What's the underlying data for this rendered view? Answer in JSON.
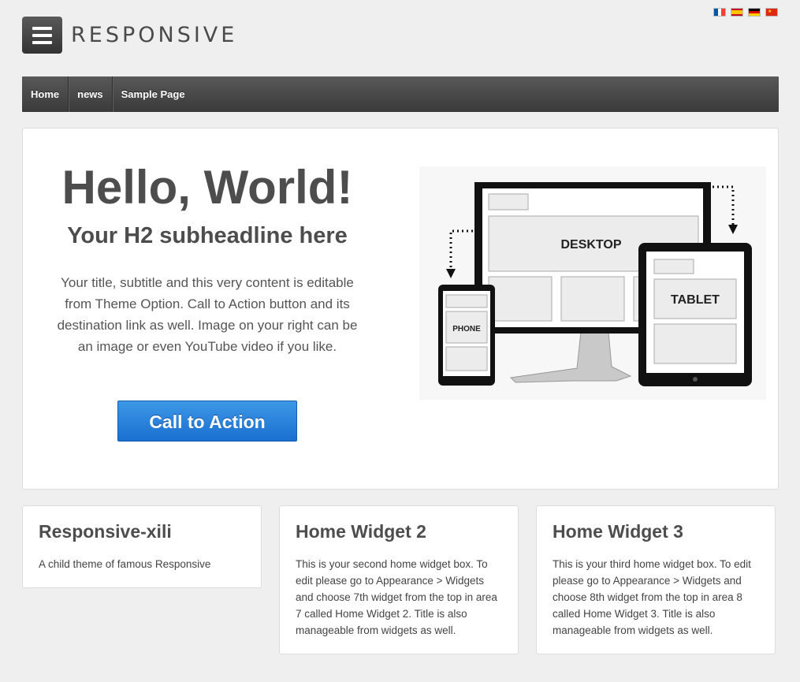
{
  "site": {
    "logo_text": "RESPONSIVE",
    "languages": [
      "French",
      "Spanish",
      "German",
      "Chinese"
    ]
  },
  "nav": {
    "items": [
      {
        "label": "Home"
      },
      {
        "label": "news"
      },
      {
        "label": "Sample Page"
      }
    ]
  },
  "featured": {
    "title": "Hello, World!",
    "subtitle": "Your H2 subheadline here",
    "content": "Your title, subtitle and this very content is editable from Theme Option. Call to Action button and its destination link as well. Image on your right can be an image or even YouTube video if you like.",
    "cta_label": "Call to Action",
    "image_labels": {
      "desktop": "DESKTOP",
      "tablet": "TABLET",
      "phone": "PHONE"
    }
  },
  "widgets": [
    {
      "title": "Responsive-xili",
      "text": "A child theme of famous Responsive"
    },
    {
      "title": "Home Widget 2",
      "text": "This is your second home widget box. To edit please go to Appearance > Widgets and choose 7th widget from the top in area 7 called Home Widget 2. Title is also manageable from widgets as well."
    },
    {
      "title": "Home Widget 3",
      "text": "This is your third home widget box. To edit please go to Appearance > Widgets and choose 8th widget from the top in area 8 called Home Widget 3. Title is also manageable from widgets as well."
    }
  ],
  "colors": {
    "background": "#efefef",
    "nav": "#444444",
    "cta": "#2a82dc",
    "heading": "#4d4d4d"
  }
}
